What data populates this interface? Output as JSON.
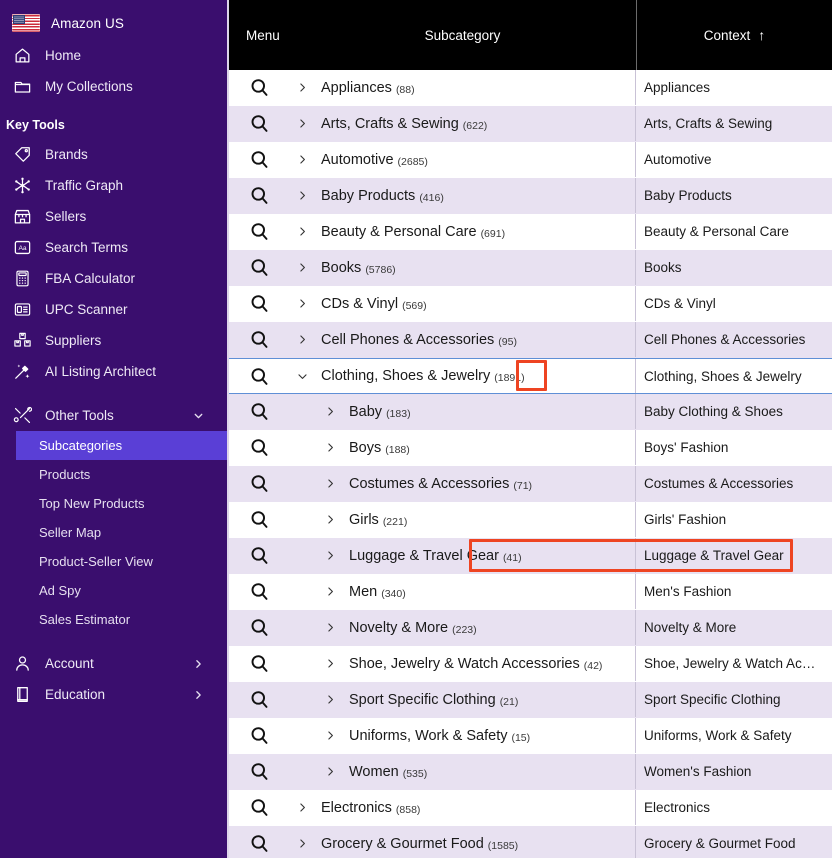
{
  "sidebar": {
    "brand": {
      "label": "Amazon US",
      "icon": "us-flag-icon"
    },
    "top_items": [
      {
        "label": "Home",
        "icon": "home-icon"
      },
      {
        "label": "My Collections",
        "icon": "folder-icon"
      }
    ],
    "key_tools_title": "Key Tools",
    "key_tools": [
      {
        "label": "Brands",
        "icon": "tag-icon"
      },
      {
        "label": "Traffic Graph",
        "icon": "network-graph-icon"
      },
      {
        "label": "Sellers",
        "icon": "storefront-icon"
      },
      {
        "label": "Search Terms",
        "icon": "text-box-icon"
      },
      {
        "label": "FBA Calculator",
        "icon": "calculator-icon"
      },
      {
        "label": "UPC Scanner",
        "icon": "scanner-panel-icon"
      },
      {
        "label": "Suppliers",
        "icon": "boxes-icon"
      },
      {
        "label": "AI Listing Architect",
        "icon": "magic-wand-icon"
      }
    ],
    "other_tools": {
      "label": "Other Tools",
      "icon": "tools-icon",
      "caret": "chevron-down-icon"
    },
    "other_tools_items": [
      {
        "label": "Subcategories",
        "active": true
      },
      {
        "label": "Products",
        "active": false
      },
      {
        "label": "Top New Products",
        "active": false
      },
      {
        "label": "Seller Map",
        "active": false
      },
      {
        "label": "Product-Seller View",
        "active": false
      },
      {
        "label": "Ad Spy",
        "active": false
      },
      {
        "label": "Sales Estimator",
        "active": false
      }
    ],
    "bottom_items": [
      {
        "label": "Account",
        "icon": "person-icon",
        "caret": "chevron-right-icon"
      },
      {
        "label": "Education",
        "icon": "book-icon",
        "caret": "chevron-right-icon"
      }
    ],
    "colors": {
      "background": "#3a0e6e",
      "active": "#5a3fd6"
    }
  },
  "table": {
    "columns": {
      "menu": "Menu",
      "subcategory": "Subcategory",
      "context": "Context",
      "context_sort": "↑"
    },
    "colors": {
      "header_bg": "#000000",
      "row_alt_bg": "#e8e1f1",
      "highlight": "#ee4422",
      "expanded_border": "#5f8fd6"
    },
    "rows": [
      {
        "name": "Appliances",
        "count": "(88)",
        "context": "Appliances",
        "level": 0,
        "state": "collapsed"
      },
      {
        "name": "Arts, Crafts & Sewing",
        "count": "(622)",
        "context": "Arts, Crafts & Sewing",
        "level": 0,
        "state": "collapsed"
      },
      {
        "name": "Automotive",
        "count": "(2685)",
        "context": "Automotive",
        "level": 0,
        "state": "collapsed"
      },
      {
        "name": "Baby Products",
        "count": "(416)",
        "context": "Baby Products",
        "level": 0,
        "state": "collapsed"
      },
      {
        "name": "Beauty & Personal Care",
        "count": "(691)",
        "context": "Beauty & Personal Care",
        "level": 0,
        "state": "collapsed"
      },
      {
        "name": "Books",
        "count": "(5786)",
        "context": "Books",
        "level": 0,
        "state": "collapsed"
      },
      {
        "name": "CDs & Vinyl",
        "count": "(569)",
        "context": "CDs & Vinyl",
        "level": 0,
        "state": "collapsed"
      },
      {
        "name": "Cell Phones & Accessories",
        "count": "(95)",
        "context": "Cell Phones & Accessories",
        "level": 0,
        "state": "collapsed"
      },
      {
        "name": "Clothing, Shoes & Jewelry",
        "count": "(1891)",
        "context": "Clothing, Shoes & Jewelry",
        "level": 0,
        "state": "expanded"
      },
      {
        "name": "Baby",
        "count": "(183)",
        "context": "Baby Clothing & Shoes",
        "level": 1,
        "state": "collapsed"
      },
      {
        "name": "Boys",
        "count": "(188)",
        "context": "Boys' Fashion",
        "level": 1,
        "state": "collapsed"
      },
      {
        "name": "Costumes & Accessories",
        "count": "(71)",
        "context": "Costumes & Accessories",
        "level": 1,
        "state": "collapsed"
      },
      {
        "name": "Girls",
        "count": "(221)",
        "context": "Girls' Fashion",
        "level": 1,
        "state": "collapsed"
      },
      {
        "name": "Luggage & Travel Gear",
        "count": "(41)",
        "context": "Luggage & Travel Gear",
        "level": 1,
        "state": "collapsed"
      },
      {
        "name": "Men",
        "count": "(340)",
        "context": "Men's Fashion",
        "level": 1,
        "state": "collapsed"
      },
      {
        "name": "Novelty & More",
        "count": "(223)",
        "context": "Novelty & More",
        "level": 1,
        "state": "collapsed"
      },
      {
        "name": "Shoe, Jewelry & Watch Accessories",
        "count": "(42)",
        "context": "Shoe, Jewelry & Watch Ac…",
        "level": 1,
        "state": "collapsed"
      },
      {
        "name": "Sport Specific Clothing",
        "count": "(21)",
        "context": "Sport Specific Clothing",
        "level": 1,
        "state": "collapsed"
      },
      {
        "name": "Uniforms, Work & Safety",
        "count": "(15)",
        "context": "Uniforms, Work & Safety",
        "level": 1,
        "state": "collapsed"
      },
      {
        "name": "Women",
        "count": "(535)",
        "context": "Women's Fashion",
        "level": 1,
        "state": "collapsed"
      },
      {
        "name": "Electronics",
        "count": "(858)",
        "context": "Electronics",
        "level": 0,
        "state": "collapsed"
      },
      {
        "name": "Grocery & Gourmet Food",
        "count": "(1585)",
        "context": "Grocery & Gourmet Food",
        "level": 0,
        "state": "collapsed"
      }
    ]
  }
}
